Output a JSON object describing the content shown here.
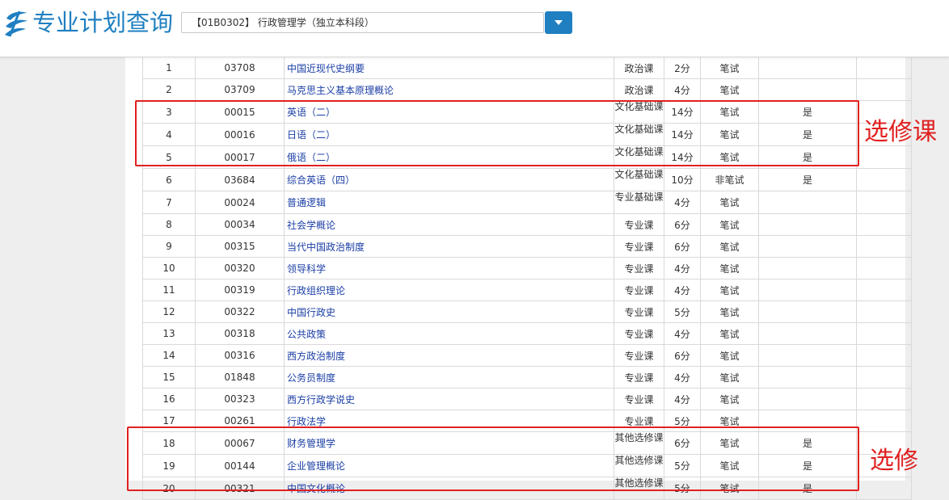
{
  "header": {
    "title": "专业计划查询",
    "selected_major": "【01B0302】 行政管理学（独立本科段）",
    "colors": {
      "brand": "#1f7fc1",
      "highlight": "#e02020",
      "link": "#1a3ea5"
    }
  },
  "courses": [
    {
      "no": "1",
      "code": "03708",
      "name": "中国近现代史纲要",
      "type": "政治课",
      "credits": "2分",
      "exam": "笔试",
      "elective": ""
    },
    {
      "no": "2",
      "code": "03709",
      "name": "马克思主义基本原理概论",
      "type": "政治课",
      "credits": "4分",
      "exam": "笔试",
      "elective": ""
    },
    {
      "no": "3",
      "code": "00015",
      "name": "英语（二）",
      "type": "文化基础课",
      "credits": "14分",
      "exam": "笔试",
      "elective": "是"
    },
    {
      "no": "4",
      "code": "00016",
      "name": "日语（二）",
      "type": "文化基础课",
      "credits": "14分",
      "exam": "笔试",
      "elective": "是"
    },
    {
      "no": "5",
      "code": "00017",
      "name": "俄语（二）",
      "type": "文化基础课",
      "credits": "14分",
      "exam": "笔试",
      "elective": "是"
    },
    {
      "no": "6",
      "code": "03684",
      "name": "综合英语（四）",
      "type": "文化基础课",
      "credits": "10分",
      "exam": "非笔试",
      "elective": "是"
    },
    {
      "no": "7",
      "code": "00024",
      "name": "普通逻辑",
      "type": "专业基础课",
      "credits": "4分",
      "exam": "笔试",
      "elective": ""
    },
    {
      "no": "8",
      "code": "00034",
      "name": "社会学概论",
      "type": "专业课",
      "credits": "6分",
      "exam": "笔试",
      "elective": ""
    },
    {
      "no": "9",
      "code": "00315",
      "name": "当代中国政治制度",
      "type": "专业课",
      "credits": "6分",
      "exam": "笔试",
      "elective": ""
    },
    {
      "no": "10",
      "code": "00320",
      "name": "领导科学",
      "type": "专业课",
      "credits": "4分",
      "exam": "笔试",
      "elective": ""
    },
    {
      "no": "11",
      "code": "00319",
      "name": "行政组织理论",
      "type": "专业课",
      "credits": "4分",
      "exam": "笔试",
      "elective": ""
    },
    {
      "no": "12",
      "code": "00322",
      "name": "中国行政史",
      "type": "专业课",
      "credits": "5分",
      "exam": "笔试",
      "elective": ""
    },
    {
      "no": "13",
      "code": "00318",
      "name": "公共政策",
      "type": "专业课",
      "credits": "4分",
      "exam": "笔试",
      "elective": ""
    },
    {
      "no": "14",
      "code": "00316",
      "name": "西方政治制度",
      "type": "专业课",
      "credits": "6分",
      "exam": "笔试",
      "elective": ""
    },
    {
      "no": "15",
      "code": "01848",
      "name": "公务员制度",
      "type": "专业课",
      "credits": "4分",
      "exam": "笔试",
      "elective": ""
    },
    {
      "no": "16",
      "code": "00323",
      "name": "西方行政学说史",
      "type": "专业课",
      "credits": "4分",
      "exam": "笔试",
      "elective": ""
    },
    {
      "no": "17",
      "code": "00261",
      "name": "行政法学",
      "type": "专业课",
      "credits": "5分",
      "exam": "笔试",
      "elective": ""
    },
    {
      "no": "18",
      "code": "00067",
      "name": "财务管理学",
      "type": "其他选修课",
      "credits": "6分",
      "exam": "笔试",
      "elective": "是"
    },
    {
      "no": "19",
      "code": "00144",
      "name": "企业管理概论",
      "type": "其他选修课",
      "credits": "5分",
      "exam": "笔试",
      "elective": "是"
    },
    {
      "no": "20",
      "code": "00321",
      "name": "中国文化概论",
      "type": "其他选修课",
      "credits": "5分",
      "exam": "笔试",
      "elective": "是"
    }
  ],
  "annotations": {
    "box1_label": "选修课",
    "box2_label": "选修"
  }
}
